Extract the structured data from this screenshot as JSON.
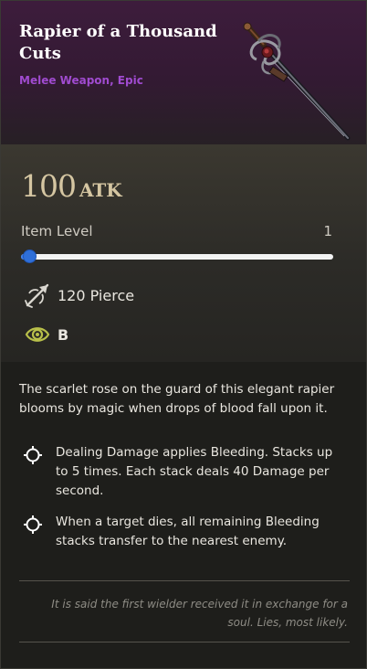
{
  "item": {
    "name": "Rapier of a Thousand Cuts",
    "type_rarity": "Melee Weapon, Epic"
  },
  "stats": {
    "atk_value": "100",
    "atk_label": "ATK",
    "item_level_label": "Item Level",
    "item_level_value": "1",
    "item_level_slider_fraction": 0.0,
    "damage_text": "120 Pierce",
    "damage_icon": "pierce-icon",
    "grade_text": "B",
    "grade_icon": "eye-icon"
  },
  "description": "The scarlet rose on the guard of this elegant rapier blooms by magic when drops of blood fall upon it.",
  "effects": [
    "Dealing Damage applies Bleeding. Stacks up to 5 times. Each stack deals 40 Damage per second.",
    "When a target dies, all remaining Bleeding stacks transfer to the nearest enemy."
  ],
  "lore": "It is said the first wielder received it in exchange for a soul. Lies, most likely.",
  "colors": {
    "rarity_purple": "#a04bd0",
    "atk_gold": "#d5c6a2",
    "slider_blue": "#3a7be8"
  }
}
